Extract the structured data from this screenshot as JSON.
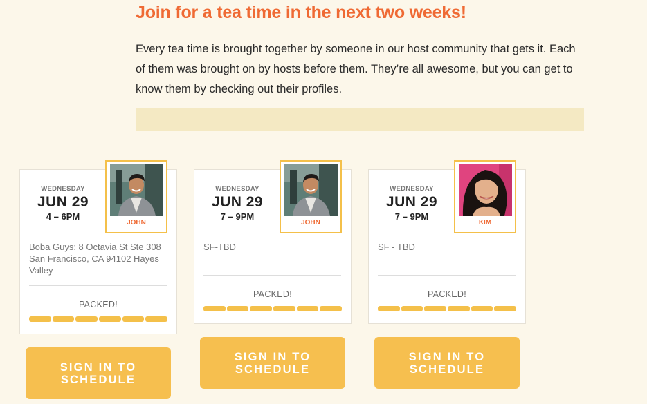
{
  "header": {
    "title": "Join for a tea time in the next two weeks!",
    "intro": "Every tea time is brought together by someone in our host community that gets it. Each of them was brought on by hosts before them. They’re all awesome, but you can get to know them by checking out their profiles."
  },
  "events": [
    {
      "weekday": "WEDNESDAY",
      "date": "JUN 29",
      "time": "4 – 6PM",
      "host": "JOHN",
      "host_photo": "john-avatar",
      "location": "Boba Guys: 8 Octavia St Ste 308 San Francisco, CA 94102 Hayes Valley",
      "status": "PACKED!",
      "capacity_filled": 6,
      "capacity_total": 6,
      "button_label": "SIGN IN TO SCHEDULE"
    },
    {
      "weekday": "WEDNESDAY",
      "date": "JUN 29",
      "time": "7 – 9PM",
      "host": "JOHN",
      "host_photo": "john-avatar",
      "location": "SF-TBD",
      "status": "PACKED!",
      "capacity_filled": 6,
      "capacity_total": 6,
      "button_label": "SIGN IN TO SCHEDULE"
    },
    {
      "weekday": "WEDNESDAY",
      "date": "JUN 29",
      "time": "7 – 9PM",
      "host": "KIM",
      "host_photo": "kim-avatar",
      "location": "SF - TBD",
      "status": "PACKED!",
      "capacity_filled": 6,
      "capacity_total": 6,
      "button_label": "SIGN IN TO SCHEDULE"
    }
  ],
  "colors": {
    "accent": "#ef6a34",
    "button": "#f6bf4f",
    "bar": "#f4c04a",
    "background": "#fcf7ea",
    "banner": "#f4e9c3"
  }
}
